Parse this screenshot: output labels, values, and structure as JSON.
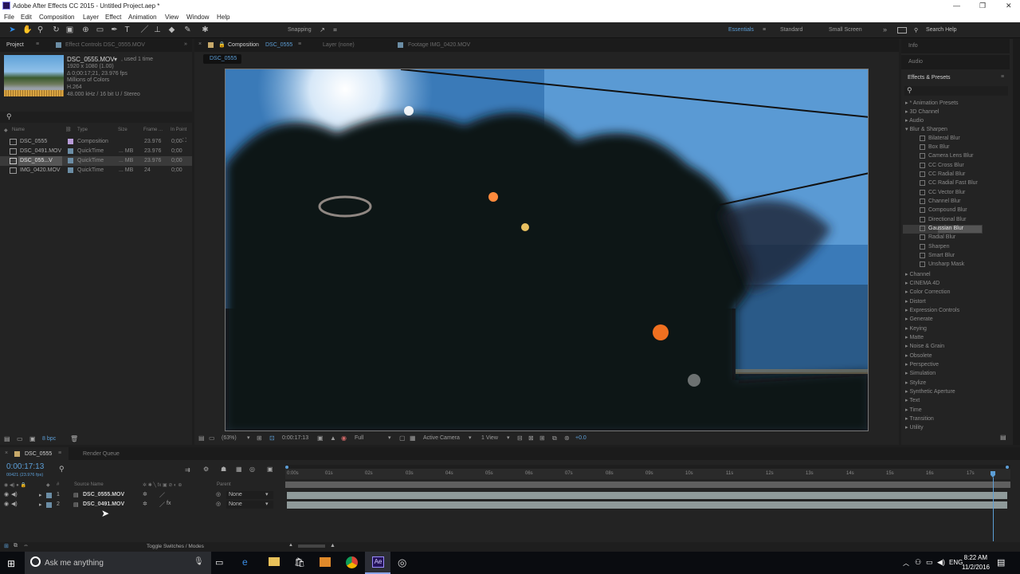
{
  "window": {
    "title": "Adobe After Effects CC 2015 - Untitled Project.aep *"
  },
  "menu": [
    "File",
    "Edit",
    "Composition",
    "Layer",
    "Effect",
    "Animation",
    "View",
    "Window",
    "Help"
  ],
  "toolbar": {
    "snapping": "Snapping",
    "workspaces": [
      "Essentials",
      "Standard",
      "Small Screen"
    ],
    "search_help": "Search Help"
  },
  "project": {
    "tab": "Project",
    "effect_controls_tab": "Effect Controls DSC_0555.MOV",
    "item_name": "DSC_0555.MOV",
    "item_used": ", used 1 time",
    "info": [
      "1920 x 1080 (1.00)",
      "Δ 0;00:17;21, 23.976 fps",
      "Millions of Colors",
      "H.264",
      "48.000 kHz / 16 bit U / Stereo"
    ],
    "columns": [
      "Name",
      "Type",
      "Size",
      "Frame ...",
      "In Point"
    ],
    "items": [
      {
        "name": "DSC_0555",
        "type": "Composition",
        "size": "",
        "fps": "23.976",
        "in": "0;00"
      },
      {
        "name": "DSC_0491.MOV",
        "type": "QuickTime",
        "size": "... MB",
        "fps": "23.976",
        "in": "0;00"
      },
      {
        "name": "DSC_055...V",
        "type": "QuickTime",
        "size": "... MB",
        "fps": "23.976",
        "in": "0;00"
      },
      {
        "name": "IMG_0420.MOV",
        "type": "QuickTime",
        "size": "... MB",
        "fps": "24",
        "in": "0;00"
      }
    ],
    "bpc": "8 bpc"
  },
  "composition": {
    "tab": "Composition",
    "tab_name": "DSC_0555",
    "layer_tab": "Layer (none)",
    "footage_tab": "Footage IMG_0420.MOV",
    "sub_tab": "DSC_0555",
    "zoom": "(63%)",
    "timecode": "0:00:17:13",
    "resolution": "Full",
    "camera": "Active Camera",
    "view": "1 View",
    "exposure": "+0.0"
  },
  "right": {
    "info": "Info",
    "audio": "Audio",
    "effects_title": "Effects & Presets",
    "categories": [
      "* Animation Presets",
      "3D Channel",
      "Audio",
      "Blur & Sharpen"
    ],
    "blur_items": [
      "Bilateral Blur",
      "Box Blur",
      "Camera Lens Blur",
      "CC Cross Blur",
      "CC Radial Blur",
      "CC Radial Fast Blur",
      "CC Vector Blur",
      "Channel Blur",
      "Compound Blur",
      "Directional Blur",
      "Gaussian Blur",
      "Radial Blur",
      "Sharpen",
      "Smart Blur",
      "Unsharp Mask"
    ],
    "more": [
      "Channel",
      "CINEMA 4D",
      "Color Correction",
      "Distort",
      "Expression Controls",
      "Generate",
      "Keying",
      "Matte",
      "Noise & Grain",
      "Obsolete",
      "Perspective",
      "Simulation",
      "Stylize",
      "Synthetic Aperture",
      "Text",
      "Time",
      "Transition",
      "Utility"
    ]
  },
  "timeline": {
    "tab": "DSC_0555",
    "render_queue": "Render Queue",
    "time": "0:00:17:13",
    "frames": "00421 (23.976 fps)",
    "col_source": "Source Name",
    "col_parent": "Parent",
    "ticks": [
      "0:00s",
      "01s",
      "02s",
      "03s",
      "04s",
      "05s",
      "06s",
      "07s",
      "08s",
      "09s",
      "10s",
      "11s",
      "12s",
      "13s",
      "14s",
      "15s",
      "16s",
      "17s"
    ],
    "layers": [
      {
        "num": "1",
        "name": "DSC_0555.MOV",
        "parent": "None"
      },
      {
        "num": "2",
        "name": "DSC_0491.MOV",
        "parent": "None"
      }
    ],
    "toggle": "Toggle Switches / Modes"
  },
  "taskbar": {
    "search": "Ask me anything",
    "lang": "ENG",
    "time": "8:22 AM",
    "date": "11/2/2016"
  }
}
